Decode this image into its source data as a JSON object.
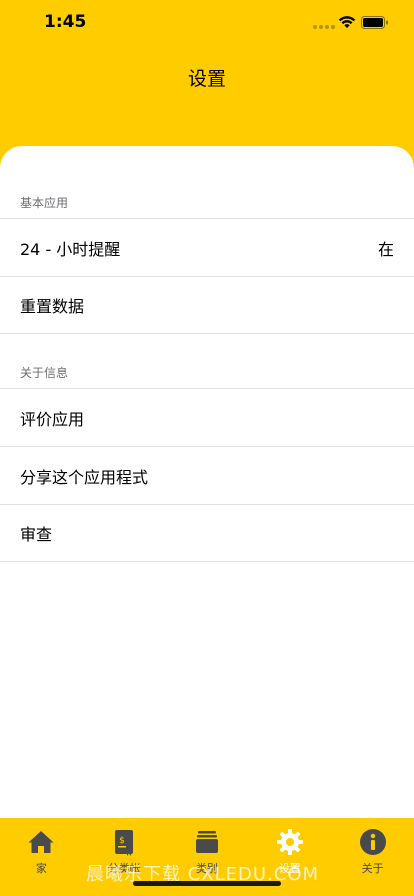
{
  "status_bar": {
    "time": "1:45"
  },
  "nav": {
    "title": "设置"
  },
  "sections": [
    {
      "header": "基本应用",
      "rows": [
        {
          "label": "24 - 小时提醒",
          "value": "在"
        },
        {
          "label": "重置数据"
        }
      ]
    },
    {
      "header": "关于信息",
      "rows": [
        {
          "label": "评价应用"
        },
        {
          "label": "分享这个应用程式"
        },
        {
          "label": "审查"
        }
      ]
    }
  ],
  "tabs": [
    {
      "label": "家",
      "icon": "home-icon"
    },
    {
      "label": "分类帐",
      "icon": "ledger-icon"
    },
    {
      "label": "类别",
      "icon": "categories-icon"
    },
    {
      "label": "设置",
      "icon": "gear-icon",
      "active": true
    },
    {
      "label": "关于",
      "icon": "info-icon"
    }
  ],
  "watermark": "晨曦乐下载 CXLEDU.COM",
  "colors": {
    "accent": "#ffcc00",
    "active_tab": "#ffffff",
    "inactive_tab": "#4a4a4a"
  }
}
